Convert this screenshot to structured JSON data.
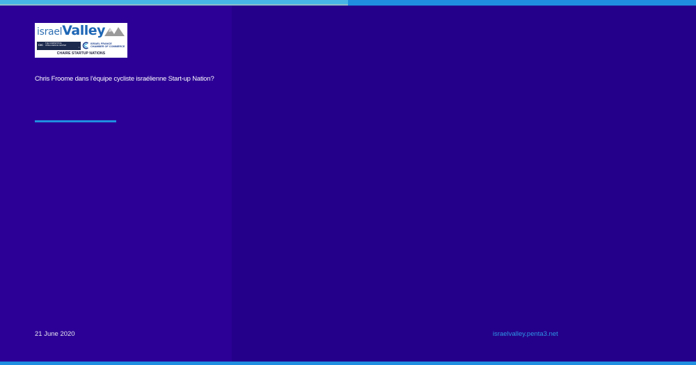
{
  "theme": {
    "background": "#24008a",
    "left_panel": "#2c0096",
    "accent": "#1f8ee0",
    "top_progress": "#47b6e6",
    "text": "#ffffff",
    "link": "#2e95e6"
  },
  "top_bar": {
    "progress_percent": 50
  },
  "logo": {
    "word_israel": "israel",
    "word_valley": "Valley",
    "cic_mark": "CIC",
    "cic_text": "THE COMPETITIVE INTELLIGENCE CENTER",
    "ccifi_text": "ISRAEL FRANCE CHAMBER OF COMMERCE",
    "chaire": "CHAIRE STARTUP NATIONS",
    "mountains_icon": "mountain-peaks-icon"
  },
  "article": {
    "title": "Chris Froome dans l’équipe cycliste israélienne Start-up Nation?"
  },
  "footer": {
    "date": "21 June 2020",
    "site": "israelvalley.penta3.net"
  }
}
